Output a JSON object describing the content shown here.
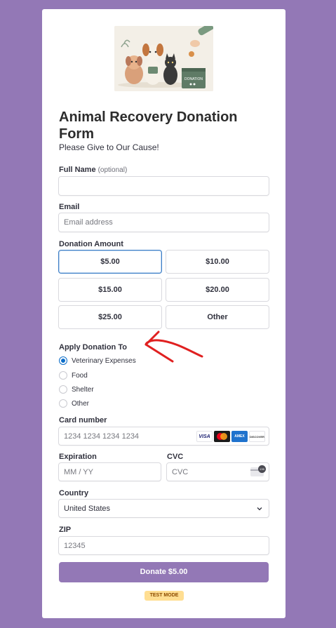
{
  "form": {
    "title": "Animal Recovery Donation Form",
    "subtitle": "Please Give to Our Cause!"
  },
  "hero": {
    "label": "DONATION",
    "description": "illustration of a dog, cat and puppy beside a donation box"
  },
  "fields": {
    "full_name_label": "Full Name",
    "full_name_optional": "(optional)",
    "full_name_value": "",
    "email_label": "Email",
    "email_placeholder": "Email address",
    "amount_label": "Donation Amount",
    "apply_label": "Apply Donation To",
    "card_label": "Card number",
    "card_placeholder": "1234 1234 1234 1234",
    "expiration_label": "Expiration",
    "expiration_placeholder": "MM / YY",
    "cvc_label": "CVC",
    "cvc_placeholder": "CVC",
    "cvc_icon_text": "135",
    "country_label": "Country",
    "country_value": "United States",
    "zip_label": "ZIP",
    "zip_placeholder": "12345"
  },
  "amounts": [
    "$5.00",
    "$10.00",
    "$15.00",
    "$20.00",
    "$25.00",
    "Other"
  ],
  "selected_amount": "$5.00",
  "apply_options": [
    "Veterinary Expenses",
    "Food",
    "Shelter",
    "Other"
  ],
  "selected_option": "Veterinary Expenses",
  "card_brands": [
    {
      "name": "VISA",
      "icon": "visa-icon"
    },
    {
      "name": "MC",
      "icon": "mastercard-icon"
    },
    {
      "name": "AMEX",
      "icon": "amex-icon"
    },
    {
      "name": "DISCOVER",
      "icon": "discover-icon"
    }
  ],
  "submit": {
    "label": "Donate $5.00"
  },
  "badge": {
    "label": "TEST MODE"
  },
  "colors": {
    "background": "#9378b6",
    "accent": "#9378b6",
    "selected_border": "#3f7fc6",
    "annotation_arrow": "#e02020",
    "badge": "#ffde92"
  }
}
